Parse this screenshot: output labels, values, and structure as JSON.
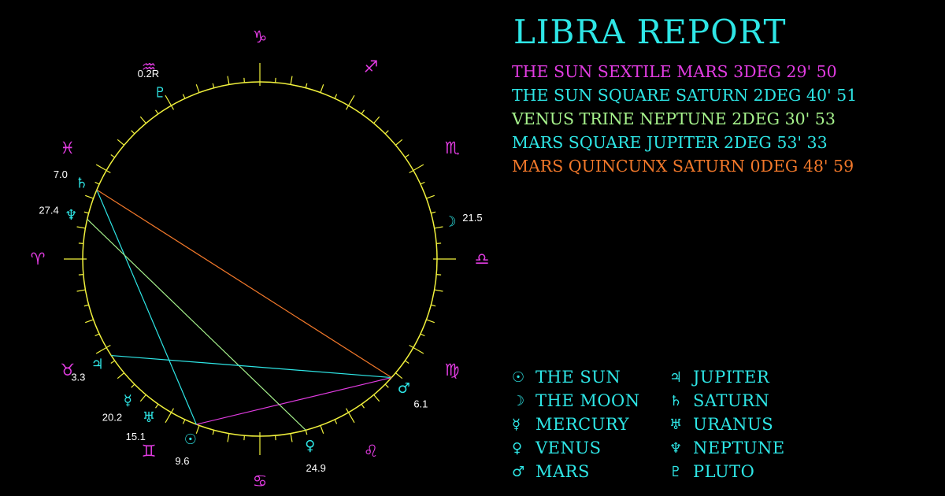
{
  "title": "LIBRA REPORT",
  "colors": {
    "background": "#000000",
    "title": "#2ee6e6",
    "wheel": "#f2f23c",
    "signs": "#e23ce2",
    "planets": "#2ee6e6",
    "degree_labels": "#ffffff"
  },
  "aspects": [
    {
      "text": "THE SUN SEXTILE MARS 3DEG 29' 50",
      "color": "#e23ce2",
      "from": "sun",
      "to": "mars"
    },
    {
      "text": "THE SUN SQUARE SATURN 2DEG 40' 51",
      "color": "#2ee6e6",
      "from": "sun",
      "to": "saturn"
    },
    {
      "text": "VENUS TRINE NEPTUNE 2DEG 30' 53",
      "color": "#a6f28c",
      "from": "venus",
      "to": "neptune"
    },
    {
      "text": "MARS SQUARE JUPITER 2DEG 53' 33",
      "color": "#2ee6e6",
      "from": "mars",
      "to": "jupiter"
    },
    {
      "text": "MARS QUINCUNX SATURN 0DEG 48' 59",
      "color": "#f2782a",
      "from": "mars",
      "to": "saturn"
    }
  ],
  "signs": [
    {
      "name": "aries",
      "glyph": "♈",
      "angle": 180
    },
    {
      "name": "taurus",
      "glyph": "♉",
      "angle": 210
    },
    {
      "name": "gemini",
      "glyph": "♊",
      "angle": 240
    },
    {
      "name": "cancer",
      "glyph": "♋",
      "angle": 270
    },
    {
      "name": "leo",
      "glyph": "♌",
      "angle": 300
    },
    {
      "name": "virgo",
      "glyph": "♍",
      "angle": 330
    },
    {
      "name": "libra",
      "glyph": "♎",
      "angle": 0
    },
    {
      "name": "scorpio",
      "glyph": "♏",
      "angle": 30
    },
    {
      "name": "sagittarius",
      "glyph": "♐",
      "angle": 60
    },
    {
      "name": "capricorn",
      "glyph": "♑",
      "angle": 90
    },
    {
      "name": "aquarius",
      "glyph": "♒",
      "angle": 120
    },
    {
      "name": "pisces",
      "glyph": "♓",
      "angle": 150
    }
  ],
  "planets": [
    {
      "name": "sun",
      "glyph": "☉",
      "degree": "9.6",
      "angle": 249
    },
    {
      "name": "moon",
      "glyph": "☽",
      "degree": "21.5",
      "angle": 11
    },
    {
      "name": "mercury",
      "glyph": "☿",
      "degree": "20.2",
      "angle": 227
    },
    {
      "name": "venus",
      "glyph": "♀",
      "degree": "24.9",
      "angle": 285
    },
    {
      "name": "mars",
      "glyph": "♂",
      "degree": "6.1",
      "angle": 318
    },
    {
      "name": "jupiter",
      "glyph": "♃",
      "degree": "3.3",
      "angle": 213
    },
    {
      "name": "saturn",
      "glyph": "♄",
      "degree": "7.0",
      "angle": 157
    },
    {
      "name": "uranus",
      "glyph": "♅",
      "degree": "15.1",
      "angle": 235
    },
    {
      "name": "neptune",
      "glyph": "♆",
      "degree": "27.4",
      "angle": 167
    },
    {
      "name": "pluto",
      "glyph": "♇",
      "degree": "0.2R",
      "angle": 121
    }
  ],
  "legend": [
    {
      "glyph": "☉",
      "label": "THE SUN"
    },
    {
      "glyph": "☽",
      "label": "THE MOON"
    },
    {
      "glyph": "☿",
      "label": "MERCURY"
    },
    {
      "glyph": "♀",
      "label": "VENUS"
    },
    {
      "glyph": "♂",
      "label": "MARS"
    },
    {
      "glyph": "♃",
      "label": "JUPITER"
    },
    {
      "glyph": "♄",
      "label": "SATURN"
    },
    {
      "glyph": "♅",
      "label": "URANUS"
    },
    {
      "glyph": "♆",
      "label": "NEPTUNE"
    },
    {
      "glyph": "♇",
      "label": "PLUTO"
    }
  ]
}
